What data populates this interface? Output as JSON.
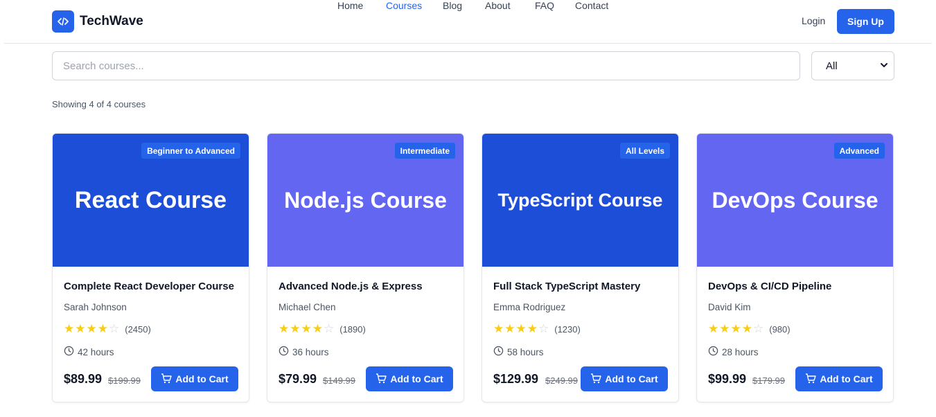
{
  "brand": {
    "name": "TechWave",
    "icon": "code-icon",
    "color": "#2563eb"
  },
  "nav": {
    "items": [
      {
        "label": "Home",
        "active": false
      },
      {
        "label": "Courses",
        "active": true
      },
      {
        "label": "Blog",
        "active": false
      },
      {
        "label": "About",
        "active": false
      },
      {
        "label": "FAQ",
        "active": false
      },
      {
        "label": "Contact",
        "active": false
      }
    ],
    "login_label": "Login",
    "signup_label": "Sign Up"
  },
  "search": {
    "placeholder": "Search courses...",
    "value": ""
  },
  "filter": {
    "selected": "All"
  },
  "results": {
    "summary": "Showing 4 of 4 courses"
  },
  "courses": [
    {
      "image_title": "React Course",
      "image_color": "#1d4ed8",
      "level": "Beginner to Advanced",
      "title": "Complete React Developer Course",
      "instructor": "Sarah Johnson",
      "rating": 4,
      "reviews": "(2450)",
      "duration": "42 hours",
      "price": "$89.99",
      "original_price": "$199.99",
      "cta": "Add to Cart"
    },
    {
      "image_title": "Node.js Course",
      "image_color": "#6366f1",
      "level": "Intermediate",
      "title": "Advanced Node.js & Express",
      "instructor": "Michael Chen",
      "rating": 4,
      "reviews": "(1890)",
      "duration": "36 hours",
      "price": "$79.99",
      "original_price": "$149.99",
      "cta": "Add to Cart"
    },
    {
      "image_title": "TypeScript Course",
      "image_color": "#1d4ed8",
      "level": "All Levels",
      "title": "Full Stack TypeScript Mastery",
      "instructor": "Emma Rodriguez",
      "rating": 4,
      "reviews": "(1230)",
      "duration": "58 hours",
      "price": "$129.99",
      "original_price": "$249.99",
      "cta": "Add to Cart"
    },
    {
      "image_title": "DevOps Course",
      "image_color": "#6366f1",
      "level": "Advanced",
      "title": "DevOps & CI/CD Pipeline",
      "instructor": "David Kim",
      "rating": 4,
      "reviews": "(980)",
      "duration": "28 hours",
      "price": "$99.99",
      "original_price": "$179.99",
      "cta": "Add to Cart"
    }
  ]
}
